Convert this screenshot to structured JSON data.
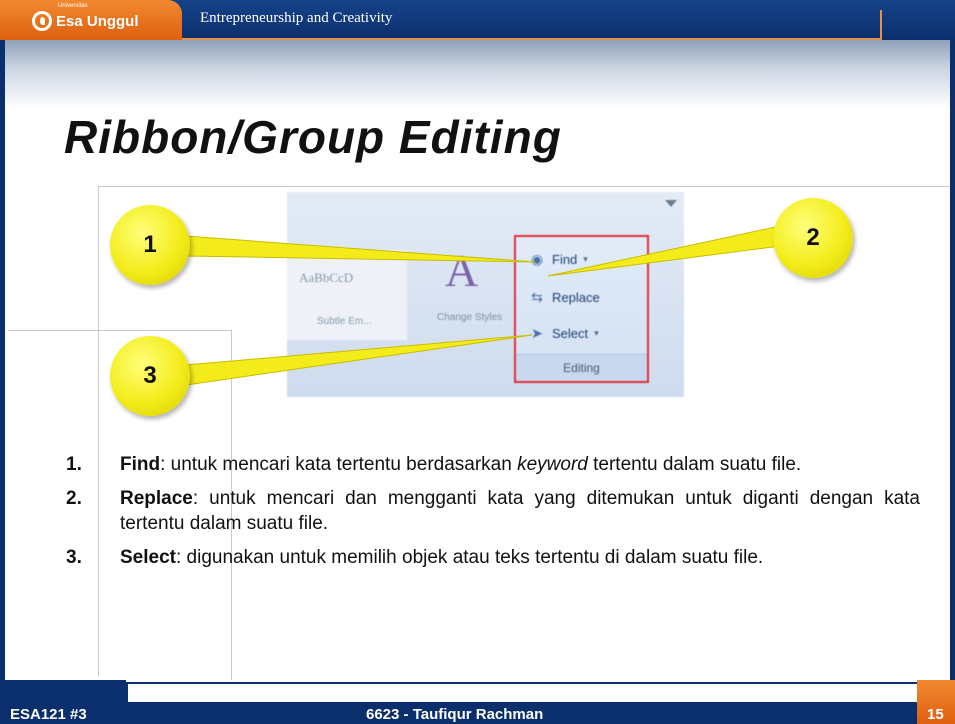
{
  "header": {
    "logo_text": "Esa Unggul",
    "logo_small": "Universitas",
    "course_title": "Entrepreneurship and Creativity"
  },
  "slide": {
    "title": "Ribbon/Group Editing"
  },
  "ribbon": {
    "style_sample": "AaBbCcD",
    "style_name": "Subtle Em...",
    "change_styles": "Change Styles",
    "find_label": "Find",
    "replace_label": "Replace",
    "select_label": "Select",
    "group_label": "Editing"
  },
  "callouts": [
    "1",
    "2",
    "3"
  ],
  "items": [
    {
      "num": "1.",
      "term": "Find",
      "pre": ": untuk mencari kata tertentu berdasarkan ",
      "em": "keyword",
      "post": " tertentu dalam suatu file."
    },
    {
      "num": "2.",
      "term": "Replace",
      "text": ": untuk mencari dan mengganti kata yang ditemukan untuk diganti dengan kata tertentu dalam suatu file."
    },
    {
      "num": "3.",
      "term": "Select",
      "text": ": digunakan untuk memilih objek atau teks tertentu di dalam suatu file."
    }
  ],
  "footer": {
    "code": "ESA121 #3",
    "author": "6623 - Taufiqur Rachman",
    "page": "15"
  },
  "colors": {
    "navy": "#0b2f6c",
    "orange": "#e9731f",
    "callout_yellow": "#f3ec1a",
    "highlight_red": "#e0303a"
  }
}
